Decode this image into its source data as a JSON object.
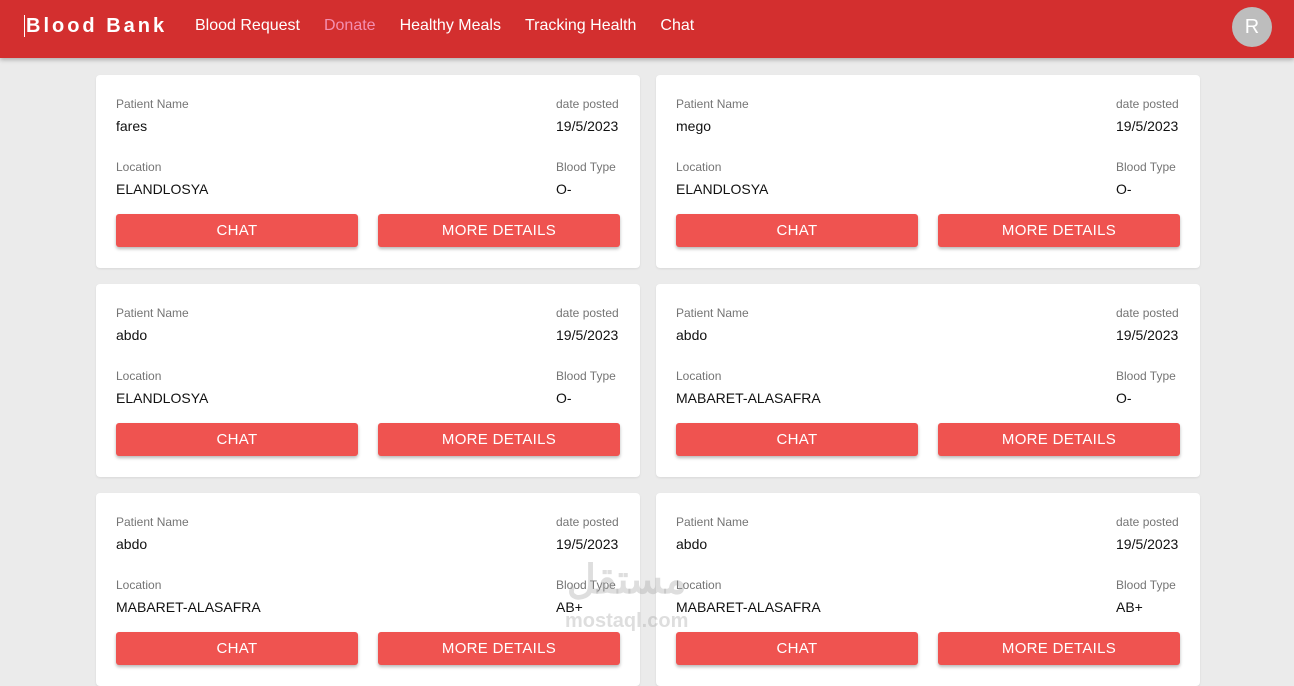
{
  "header": {
    "brand": "Blood Bank",
    "nav": [
      "Blood Request",
      "Donate",
      "Healthy Meals",
      "Tracking Health",
      "Chat"
    ],
    "active_nav": "Donate",
    "avatar_initial": "R"
  },
  "labels": {
    "patient_name": "Patient Name",
    "date_posted": "date posted",
    "location": "Location",
    "blood_type": "Blood Type",
    "chat_button": "CHAT",
    "details_button": "MORE DETAILS"
  },
  "cards": [
    {
      "patient_name": "fares",
      "date_posted": "19/5/2023",
      "location": "ELANDLOSYA",
      "blood_type": "O-"
    },
    {
      "patient_name": "mego",
      "date_posted": "19/5/2023",
      "location": "ELANDLOSYA",
      "blood_type": "O-"
    },
    {
      "patient_name": "abdo",
      "date_posted": "19/5/2023",
      "location": "ELANDLOSYA",
      "blood_type": "O-"
    },
    {
      "patient_name": "abdo",
      "date_posted": "19/5/2023",
      "location": "MABARET-ALASAFRA",
      "blood_type": "O-"
    },
    {
      "patient_name": "abdo",
      "date_posted": "19/5/2023",
      "location": "MABARET-ALASAFRA",
      "blood_type": "AB+"
    },
    {
      "patient_name": "abdo",
      "date_posted": "19/5/2023",
      "location": "MABARET-ALASAFRA",
      "blood_type": "AB+"
    }
  ],
  "watermark": {
    "arabic": "مستقل",
    "latin": "mostaql.com"
  },
  "colors": {
    "header": "#d32f2f",
    "button": "#ef5350",
    "active_nav": "#f48fb1"
  }
}
